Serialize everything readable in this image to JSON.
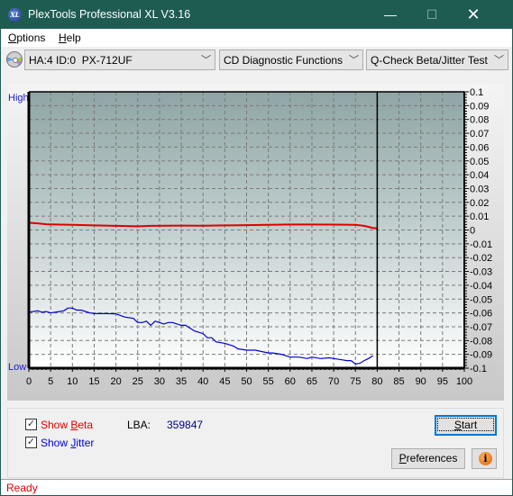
{
  "window": {
    "title": "PlexTools Professional XL V3.16",
    "icon_label": "XL",
    "controls": {
      "minimize": "—",
      "maximize": "☐",
      "close": "✕"
    }
  },
  "menu": [
    {
      "label": "Options",
      "accel": "O"
    },
    {
      "label": "Help",
      "accel": "H"
    }
  ],
  "toolbar": {
    "drive": "HA:4 ID:0  PX-712UF",
    "function": "CD Diagnostic Functions",
    "test": "Q-Check Beta/Jitter Test",
    "chevron": "﹀"
  },
  "chart_data": {
    "type": "line",
    "title": "",
    "left_axis_labels": {
      "high": "High",
      "low": "Low"
    },
    "xlabel": "",
    "ylabel": "",
    "xlim": [
      0,
      100
    ],
    "ylim": [
      -0.1,
      0.1
    ],
    "x_ticks": [
      0,
      5,
      10,
      15,
      20,
      25,
      30,
      35,
      40,
      45,
      50,
      55,
      60,
      65,
      70,
      75,
      80,
      85,
      90,
      95,
      100
    ],
    "y_ticks": [
      0.1,
      0.09,
      0.08,
      0.07,
      0.06,
      0.05,
      0.04,
      0.03,
      0.02,
      0.01,
      0,
      -0.01,
      -0.02,
      -0.03,
      -0.04,
      -0.05,
      -0.06,
      -0.07,
      -0.08,
      -0.09,
      -0.1
    ],
    "y_tick_labels": [
      "0.1",
      "0.09",
      "0.08",
      "0.07",
      "0.06",
      "0.05",
      "0.04",
      "0.03",
      "0.02",
      "0.01",
      "0",
      "-0.01",
      "-0.02",
      "-0.03",
      "-0.04",
      "-0.05",
      "-0.06",
      "-0.07",
      "-0.08",
      "-0.09",
      "-0.1"
    ],
    "grid": true,
    "end_marker_x": 80,
    "series": [
      {
        "name": "Beta",
        "color": "#e00000",
        "x": [
          0,
          2,
          4,
          6,
          10,
          15,
          20,
          25,
          28,
          35,
          40,
          45,
          50,
          55,
          60,
          65,
          70,
          75,
          77,
          79,
          80
        ],
        "y": [
          0.0052,
          0.0048,
          0.0042,
          0.004,
          0.0038,
          0.0033,
          0.003,
          0.0027,
          0.003,
          0.0032,
          0.0031,
          0.0033,
          0.0035,
          0.0038,
          0.004,
          0.004,
          0.0039,
          0.0038,
          0.003,
          0.0015,
          0.0012
        ]
      },
      {
        "name": "Jitter",
        "color": "#0000d0",
        "x": [
          0,
          2,
          3,
          4,
          5,
          6,
          7,
          8,
          9,
          10,
          11,
          12,
          14,
          15,
          18,
          20,
          22,
          24,
          25,
          26,
          27,
          28,
          29,
          30,
          31,
          32,
          33,
          35,
          36,
          37,
          38,
          40,
          41,
          42,
          43,
          45,
          46,
          47,
          48,
          50,
          52,
          55,
          56,
          58,
          60,
          62,
          64,
          65,
          67,
          69,
          70,
          72,
          73,
          74,
          75,
          76,
          77,
          78,
          79
        ],
        "y": [
          -0.0595,
          -0.0585,
          -0.0595,
          -0.059,
          -0.06,
          -0.0595,
          -0.059,
          -0.0585,
          -0.0565,
          -0.0565,
          -0.058,
          -0.058,
          -0.06,
          -0.0605,
          -0.0605,
          -0.0607,
          -0.063,
          -0.064,
          -0.067,
          -0.067,
          -0.066,
          -0.069,
          -0.066,
          -0.067,
          -0.068,
          -0.067,
          -0.067,
          -0.069,
          -0.069,
          -0.071,
          -0.073,
          -0.075,
          -0.078,
          -0.078,
          -0.081,
          -0.082,
          -0.083,
          -0.084,
          -0.086,
          -0.087,
          -0.087,
          -0.089,
          -0.089,
          -0.09,
          -0.092,
          -0.092,
          -0.093,
          -0.092,
          -0.093,
          -0.0925,
          -0.093,
          -0.094,
          -0.0945,
          -0.0945,
          -0.097,
          -0.0965,
          -0.0945,
          -0.093,
          -0.091
        ]
      }
    ]
  },
  "controls": {
    "show_beta": {
      "label_pre": "Show ",
      "accel": "B",
      "label_post": "eta",
      "checked": true,
      "color": "#e00000"
    },
    "show_jitter": {
      "label_pre": "Show ",
      "accel": "J",
      "label_post": "itter",
      "checked": true,
      "color": "#0000e0"
    },
    "lba_label": "LBA:",
    "lba_value": "359847",
    "start_button": {
      "accel": "S",
      "rest": "tart"
    },
    "preferences_button": {
      "accel": "P",
      "rest": "references"
    },
    "info_icon": "i"
  },
  "status": {
    "text": "Ready"
  }
}
